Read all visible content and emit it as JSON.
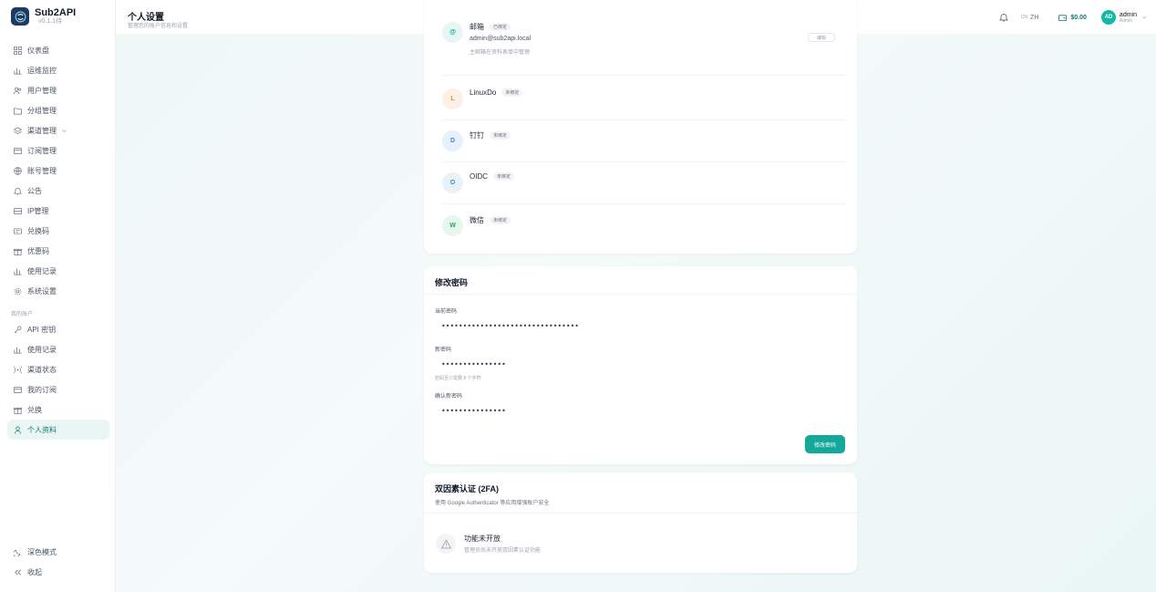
{
  "brand": {
    "name": "Sub2API",
    "version": "v0.1.1待"
  },
  "sidebar": {
    "admin_items": [
      {
        "label": "仪表盘",
        "icon": "grid-icon"
      },
      {
        "label": "运维监控",
        "icon": "chart-icon"
      },
      {
        "label": "用户管理",
        "icon": "users-icon"
      },
      {
        "label": "分组管理",
        "icon": "folder-icon"
      },
      {
        "label": "渠道管理",
        "icon": "layers-icon"
      },
      {
        "label": "订阅管理",
        "icon": "card-icon"
      },
      {
        "label": "账号管理",
        "icon": "globe-icon"
      },
      {
        "label": "公告",
        "icon": "bell-icon"
      },
      {
        "label": "IP管理",
        "icon": "server-icon"
      },
      {
        "label": "兑换码",
        "icon": "ticket-icon"
      },
      {
        "label": "优惠码",
        "icon": "gift-icon"
      },
      {
        "label": "使用记录",
        "icon": "chart-icon"
      },
      {
        "label": "系统设置",
        "icon": "gear-icon"
      }
    ],
    "section_label": "我的账户",
    "user_items": [
      {
        "label": "API 密钥",
        "icon": "key-icon"
      },
      {
        "label": "使用记录",
        "icon": "chart-icon"
      },
      {
        "label": "渠道状态",
        "icon": "signal-icon"
      },
      {
        "label": "我的订阅",
        "icon": "card-icon"
      },
      {
        "label": "兑换",
        "icon": "gift-icon"
      },
      {
        "label": "个人资料",
        "icon": "person-icon"
      }
    ],
    "bottom_items": [
      {
        "label": "深色模式",
        "icon": "moon-icon"
      },
      {
        "label": "收起",
        "icon": "collapse-icon"
      }
    ]
  },
  "header": {
    "title": "个人设置",
    "subtitle": "管理您的账户信息和设置",
    "lang_flag": "CN",
    "lang": "ZH",
    "balance": "$0.00",
    "avatar_initials": "AD",
    "user_name": "admin",
    "user_role": "Admin"
  },
  "accounts": {
    "email": {
      "icon_letter": "@",
      "title": "邮箱",
      "badge": "已绑定",
      "value": "admin@sub2api.local",
      "hint": "主邮箱在资料表单中管理",
      "button": "编辑"
    },
    "items": [
      {
        "letter": "L",
        "title": "LinuxDo",
        "badge": "未绑定"
      },
      {
        "letter": "D",
        "title": "钉钉",
        "badge": "未绑定"
      },
      {
        "letter": "O",
        "title": "OIDC",
        "badge": "未绑定"
      },
      {
        "letter": "W",
        "title": "微信",
        "badge": "未绑定"
      }
    ]
  },
  "password": {
    "title": "修改密码",
    "current_label": "当前密码",
    "current_value": "••••••••••••••••••••••••••••••••",
    "new_label": "新密码",
    "new_value": "•••••••••••••••",
    "new_help": "密码至少需要 8 个字符",
    "confirm_label": "确认新密码",
    "confirm_value": "•••••••••••••••",
    "submit": "修改密码"
  },
  "twofa": {
    "title": "双因素认证 (2FA)",
    "subtitle": "使用 Google Authenticator 等应用增强账户安全",
    "status_title": "功能未开放",
    "status_desc": "管理员尚未开放双因素认证功能"
  },
  "colors": {
    "accent": "#14a89a",
    "brand_dark": "#1e3a5f"
  }
}
